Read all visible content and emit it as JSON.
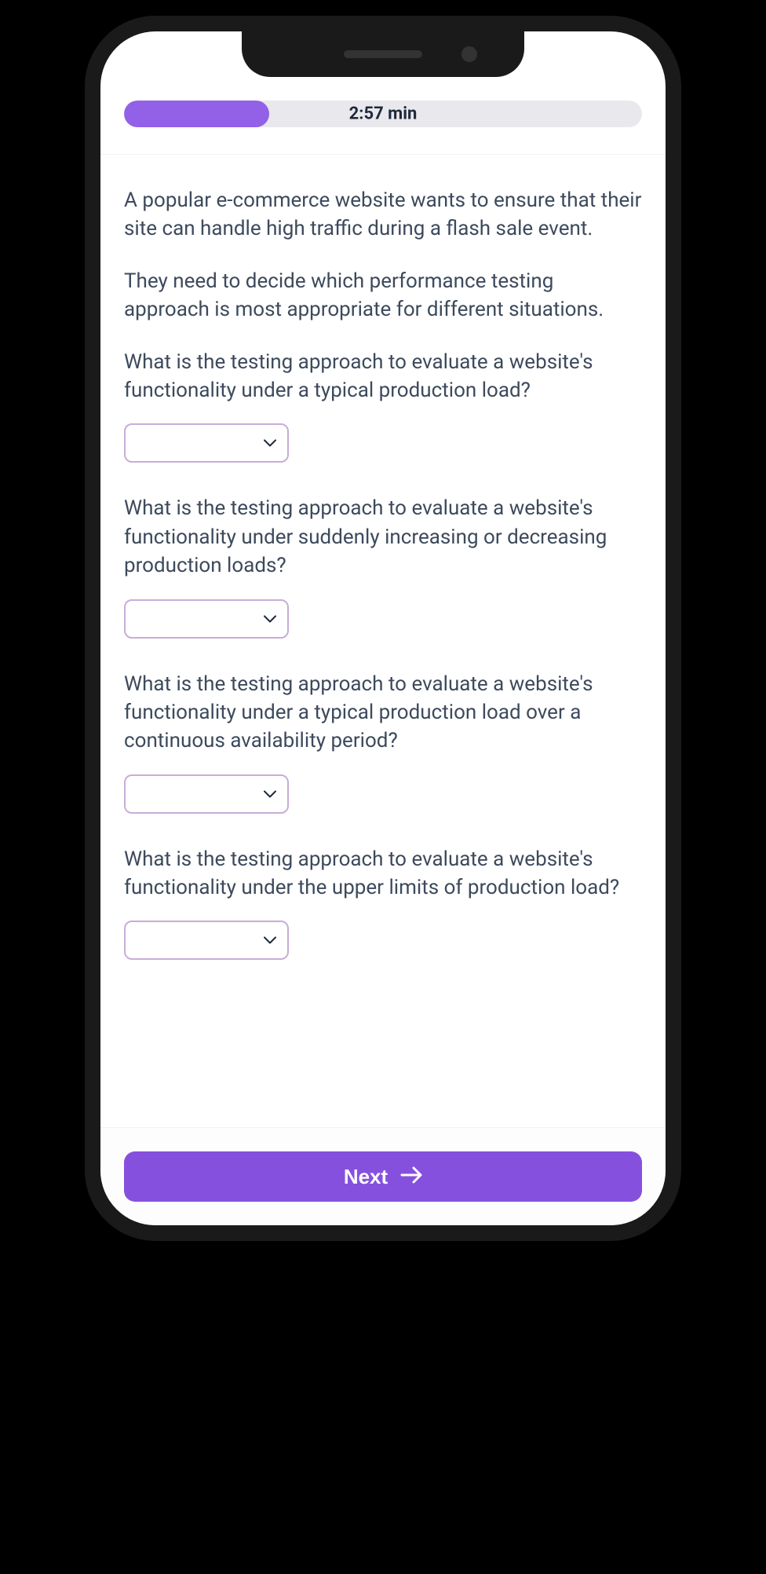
{
  "timer": "2:57 min",
  "progress_percent": 28,
  "scenario": {
    "paragraph1": "A popular e-commerce website wants to ensure that their site can handle high traffic during a flash sale event.",
    "paragraph2": "They need to decide which performance testing approach is most appropriate for different situations."
  },
  "questions": [
    {
      "text": "What is the testing approach to evaluate a website's functionality under a typical production load?",
      "selected": ""
    },
    {
      "text": "What is the testing approach to evaluate a website's functionality under suddenly increasing or decreasing production loads?",
      "selected": ""
    },
    {
      "text": "What is the testing approach to evaluate a website's functionality under a typical production load over a continuous availability period?",
      "selected": ""
    },
    {
      "text": "What is the testing approach to evaluate a website's functionality under the upper limits of production load?",
      "selected": ""
    }
  ],
  "footer": {
    "next_label": "Next"
  },
  "colors": {
    "accent": "#8650df",
    "progress": "#9360e8",
    "select_border": "#c8add8",
    "text": "#3d4a5c"
  }
}
